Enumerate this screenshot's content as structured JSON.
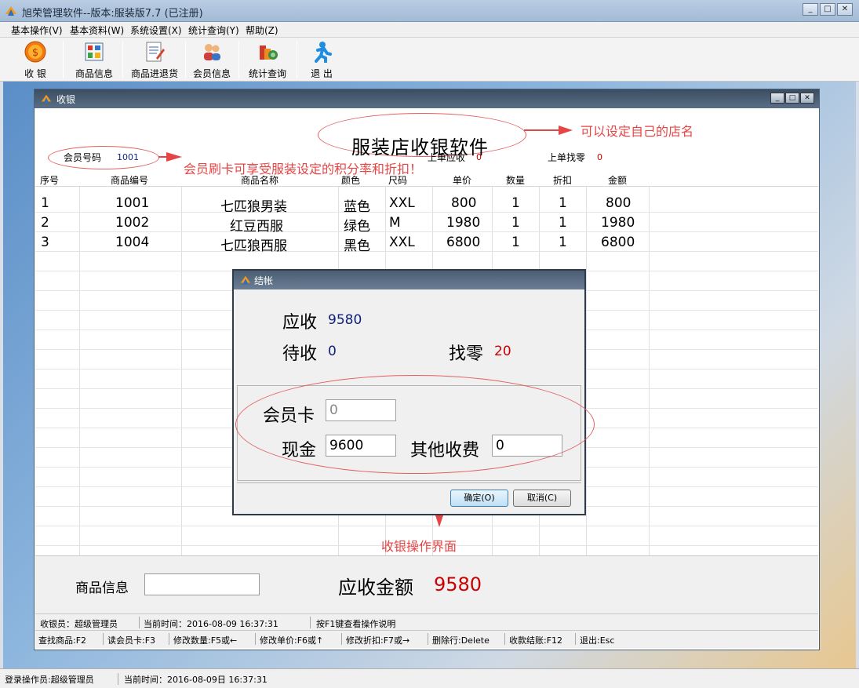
{
  "window": {
    "title": "旭荣管理软件--版本:服装版7.7 (已注册)",
    "controls": [
      "_",
      "□",
      "✕"
    ]
  },
  "menu": [
    "基本操作(V)",
    "基本资料(W)",
    "系统设置(X)",
    "统计查询(Y)",
    "帮助(Z)"
  ],
  "toolbar": [
    {
      "label": "收 银",
      "icon": "cashier-coin-icon"
    },
    {
      "label": "商品信息",
      "icon": "goods-grid-icon"
    },
    {
      "label": "商品进退货",
      "icon": "goods-inout-icon"
    },
    {
      "label": "会员信息",
      "icon": "members-icon"
    },
    {
      "label": "统计查询",
      "icon": "statistics-icon"
    },
    {
      "label": "退 出",
      "icon": "exit-runner-icon"
    }
  ],
  "cashier": {
    "title": "收银",
    "shop_name": "服装店收银软件",
    "member_label": "会员号码",
    "member_value": "1001",
    "last_due_label": "上单应收",
    "last_due_value": "0",
    "last_change_label": "上单找零",
    "last_change_value": "0",
    "columns": [
      "序号",
      "商品编号",
      "商品名称",
      "颜色",
      "尺码",
      "单价",
      "数量",
      "折扣",
      "金额"
    ],
    "rows": [
      [
        "1",
        "1001",
        "七匹狼男装",
        "蓝色",
        "XXL",
        "800",
        "1",
        "1",
        "800"
      ],
      [
        "2",
        "1002",
        "红豆西服",
        "绿色",
        "M",
        "1980",
        "1",
        "1",
        "1980"
      ],
      [
        "3",
        "1004",
        "七匹狼西服",
        "黑色",
        "XXL",
        "6800",
        "1",
        "1",
        "6800"
      ]
    ],
    "goods_info_label": "商品信息",
    "goods_info_value": "",
    "due_label": "应收金额",
    "due_value": "9580",
    "status1": [
      "收银员：超级管理员",
      "当前时间：2016-08-09 16:37:31",
      "按F1键查看操作说明"
    ],
    "status2": [
      "查找商品:F2",
      "读会员卡:F3",
      "修改数量:F5或←",
      "修改单价:F6或↑",
      "修改折扣:F7或→",
      "删除行:Delete",
      "收款结账:F12",
      "退出:Esc"
    ]
  },
  "annotations": {
    "shop_name": "可以设定自己的店名",
    "member": "会员刷卡可享受服装设定的积分率和折扣！",
    "dialog": "收银操作界面"
  },
  "checkout": {
    "title": "结帐",
    "due_label": "应收",
    "due_value": "9580",
    "pending_label": "待收",
    "pending_value": "0",
    "change_label": "找零",
    "change_value": "20",
    "card_label": "会员卡",
    "card_value": "0",
    "cash_label": "现金",
    "cash_value": "9600",
    "other_label": "其他收费",
    "other_value": "0",
    "ok_label": "确定(O)",
    "cancel_label": "取消(C)"
  },
  "main_status": [
    "登录操作员:超级管理员",
    "当前时间：2016-08-09日 16:37:31"
  ],
  "colors": {
    "annotation": "#e64545",
    "value_blue": "#10207a",
    "value_red": "#cc0000"
  }
}
